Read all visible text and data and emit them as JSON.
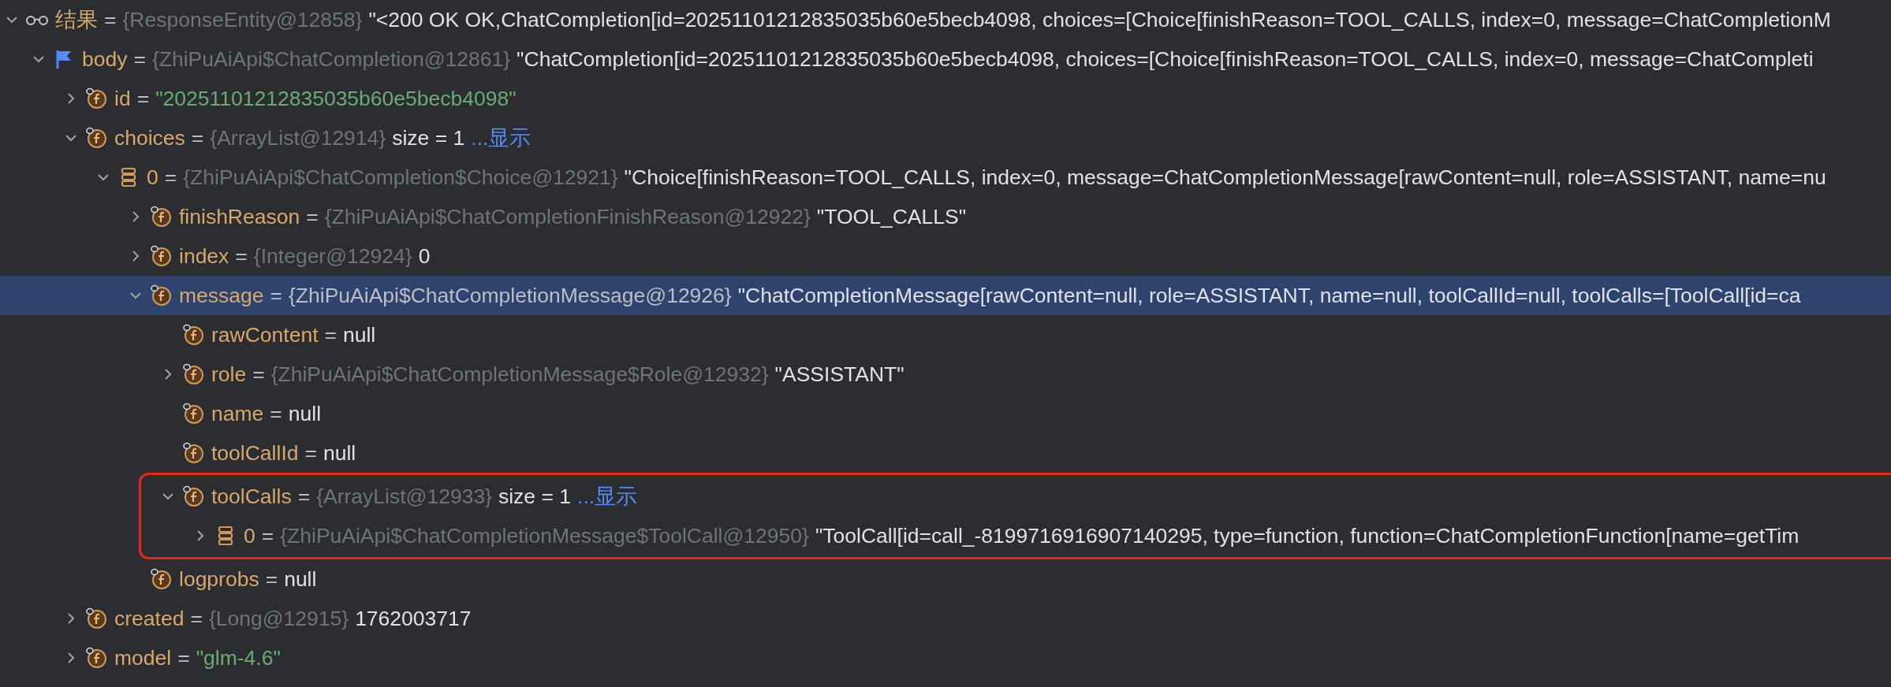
{
  "tree": [
    {
      "kind": "watch",
      "name": "结果",
      "sep": "=",
      "type": "{ResponseEntity@12858}",
      "value": "\"<200 OK OK,ChatCompletion[id=20251101212835035b60e5becb4098, choices=[Choice[finishReason=TOOL_CALLS, index=0, message=ChatCompletionM",
      "string_literal": false,
      "expanded": true,
      "selected": false,
      "children": [
        {
          "kind": "flag",
          "name": "body",
          "sep": "=",
          "type": "{ZhiPuAiApi$ChatCompletion@12861}",
          "value": "\"ChatCompletion[id=20251101212835035b60e5becb4098, choices=[Choice[finishReason=TOOL_CALLS, index=0, message=ChatCompleti",
          "string_literal": false,
          "expanded": true,
          "selected": false,
          "children": [
            {
              "kind": "field",
              "name": "id",
              "sep": "=",
              "value": "\"20251101212835035b60e5becb4098\"",
              "string_literal": true,
              "expanded": false,
              "selected": false
            },
            {
              "kind": "field",
              "name": "choices",
              "sep": "=",
              "type": "{ArrayList@12914}",
              "value": "size = 1",
              "string_literal": false,
              "link": "...显示",
              "expanded": true,
              "selected": false,
              "children": [
                {
                  "kind": "element",
                  "name": "0",
                  "sep": "=",
                  "type": "{ZhiPuAiApi$ChatCompletion$Choice@12921}",
                  "value": "\"Choice[finishReason=TOOL_CALLS, index=0, message=ChatCompletionMessage[rawContent=null, role=ASSISTANT, name=nu",
                  "string_literal": false,
                  "expanded": true,
                  "selected": false,
                  "children": [
                    {
                      "kind": "field",
                      "name": "finishReason",
                      "sep": "=",
                      "type": "{ZhiPuAiApi$ChatCompletionFinishReason@12922}",
                      "value": "\"TOOL_CALLS\"",
                      "string_literal": false,
                      "expanded": false,
                      "selected": false
                    },
                    {
                      "kind": "field",
                      "name": "index",
                      "sep": "=",
                      "type": "{Integer@12924}",
                      "value": "0",
                      "string_literal": false,
                      "expanded": false,
                      "selected": false
                    },
                    {
                      "kind": "field",
                      "name": "message",
                      "sep": "=",
                      "type": "{ZhiPuAiApi$ChatCompletionMessage@12926}",
                      "value": "\"ChatCompletionMessage[rawContent=null, role=ASSISTANT, name=null, toolCallId=null, toolCalls=[ToolCall[id=ca",
                      "string_literal": false,
                      "expanded": true,
                      "selected": true,
                      "children": [
                        {
                          "kind": "field",
                          "name": "rawContent",
                          "sep": "=",
                          "value": "null",
                          "string_literal": false,
                          "selected": false
                        },
                        {
                          "kind": "field",
                          "name": "role",
                          "sep": "=",
                          "type": "{ZhiPuAiApi$ChatCompletionMessage$Role@12932}",
                          "value": "\"ASSISTANT\"",
                          "string_literal": false,
                          "expanded": false,
                          "selected": false
                        },
                        {
                          "kind": "field",
                          "name": "name",
                          "sep": "=",
                          "value": "null",
                          "string_literal": false,
                          "selected": false
                        },
                        {
                          "kind": "field",
                          "name": "toolCallId",
                          "sep": "=",
                          "value": "null",
                          "string_literal": false,
                          "selected": false
                        },
                        {
                          "kind": "field",
                          "name": "toolCalls",
                          "sep": "=",
                          "type": "{ArrayList@12933}",
                          "value": "size = 1",
                          "string_literal": false,
                          "link": "...显示",
                          "expanded": true,
                          "selected": false,
                          "annotated": true,
                          "children": [
                            {
                              "kind": "element",
                              "name": "0",
                              "sep": "=",
                              "type": "{ZhiPuAiApi$ChatCompletionMessage$ToolCall@12950}",
                              "value": "\"ToolCall[id=call_-8199716916907140295, type=function, function=ChatCompletionFunction[name=getTim",
                              "string_literal": false,
                              "expanded": false,
                              "selected": false
                            }
                          ]
                        }
                      ]
                    },
                    {
                      "kind": "field",
                      "name": "logprobs",
                      "sep": "=",
                      "value": "null",
                      "string_literal": false,
                      "selected": false
                    }
                  ]
                }
              ]
            },
            {
              "kind": "field",
              "name": "created",
              "sep": "=",
              "type": "{Long@12915}",
              "value": "1762003717",
              "string_literal": false,
              "expanded": false,
              "selected": false
            },
            {
              "kind": "field",
              "name": "model",
              "sep": "=",
              "value": "\"glm-4.6\"",
              "string_literal": true,
              "expanded": false,
              "selected": false
            }
          ]
        }
      ]
    }
  ]
}
